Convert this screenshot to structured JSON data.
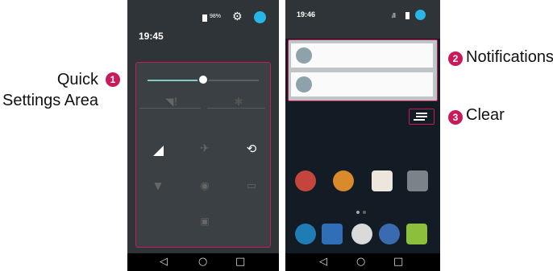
{
  "callouts": {
    "quick": {
      "number": "1",
      "line1": "Quick",
      "line2": "Settings Area"
    },
    "notifications": {
      "number": "2",
      "label": "Notifications"
    },
    "clear": {
      "number": "3",
      "label": "Clear"
    }
  },
  "left_phone": {
    "time": "19:45",
    "battery": "98%",
    "icons": [
      "battery-icon",
      "gear-icon",
      "account-icon",
      "brightness-icon",
      "wifi-icon",
      "bluetooth-icon",
      "signal-icon",
      "airplane-icon",
      "rotation-icon",
      "flashlight-icon",
      "location-off-icon",
      "cast-icon",
      "screen-icon"
    ],
    "brightness_level": 0.45
  },
  "right_phone": {
    "time": "19:46",
    "icons": [
      "wifi-icon",
      "signal-icon",
      "battery-icon",
      "account-icon",
      "wifi-icon",
      "usb-icon",
      "clear-all-icon",
      "google-icon",
      "chrome-icon",
      "store-icon",
      "camera-icon",
      "phone-icon",
      "contacts-icon",
      "apps-icon",
      "browser-icon",
      "messaging-icon"
    ]
  },
  "nav": {
    "back": "◁",
    "home": "○",
    "recent": "□"
  },
  "colors": {
    "accent": "#c81b5a",
    "teal": "#80cbc4",
    "account": "#27b6e6"
  }
}
